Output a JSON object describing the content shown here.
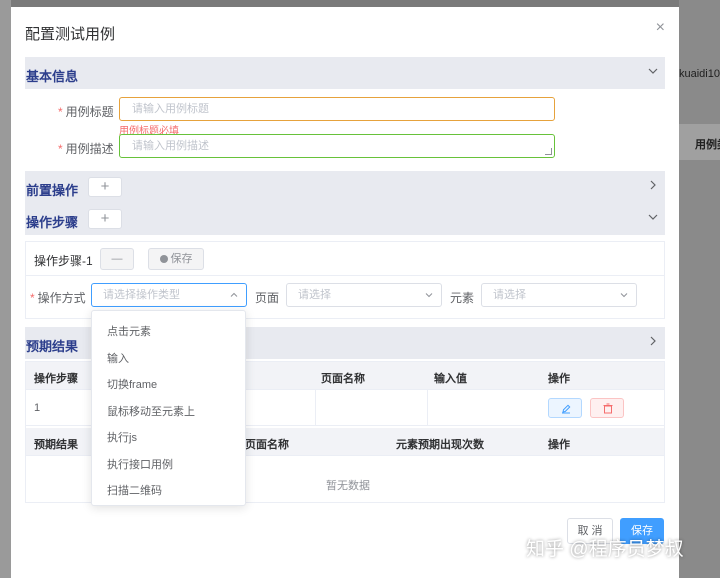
{
  "background": {
    "right_text_1": "kuaidi10",
    "right_text_2": "用例类"
  },
  "modal": {
    "title": "配置测试用例",
    "close_glyph": "×"
  },
  "basic_info": {
    "title": "基本信息",
    "case_title_label": "用例标题",
    "case_title_placeholder": "请输入用例标题",
    "case_title_error": "用例标题必填",
    "case_desc_label": "用例描述",
    "case_desc_placeholder": "请输入用例描述"
  },
  "pre_ops": {
    "title": "前置操作",
    "add_glyph": "+"
  },
  "steps": {
    "title": "操作步骤",
    "add_glyph": "+",
    "step_label": "操作步骤-1",
    "remove_glyph": "—",
    "save_label": "保存",
    "op_mode_label": "操作方式",
    "op_mode_placeholder": "请选择操作类型",
    "page_label": "页面",
    "page_placeholder": "请选择",
    "element_label": "元素",
    "element_placeholder": "请选择"
  },
  "dropdown": {
    "options": [
      "点击元素",
      "输入",
      "切换frame",
      "鼠标移动至元素上",
      "执行js",
      "执行接口用例",
      "扫描二维码"
    ]
  },
  "expected": {
    "title": "预期结果",
    "table1": {
      "headers": [
        "操作步骤",
        "页面名称",
        "输入值",
        "操作"
      ],
      "rows": [
        [
          "1",
          "",
          ""
        ]
      ]
    },
    "table2": {
      "headers": [
        "预期结果",
        "页面名称",
        "元素预期出现次数",
        "操作"
      ],
      "empty_text": "暂无数据"
    }
  },
  "footer": {
    "cancel_label": "取 消",
    "save_label": "保存"
  },
  "watermark": "知乎 @程序员梦叔",
  "colors": {
    "primary": "#409eff",
    "danger": "#f56c6c",
    "success": "#67c23a",
    "section_bg": "#e8eaf0",
    "section_title": "#2c3e8c"
  },
  "icons": {
    "close": "close-icon",
    "chevron_down": "chevron-down-icon",
    "chevron_right": "chevron-right-icon",
    "save": "save-icon",
    "edit": "edit-icon",
    "delete": "delete-icon"
  }
}
